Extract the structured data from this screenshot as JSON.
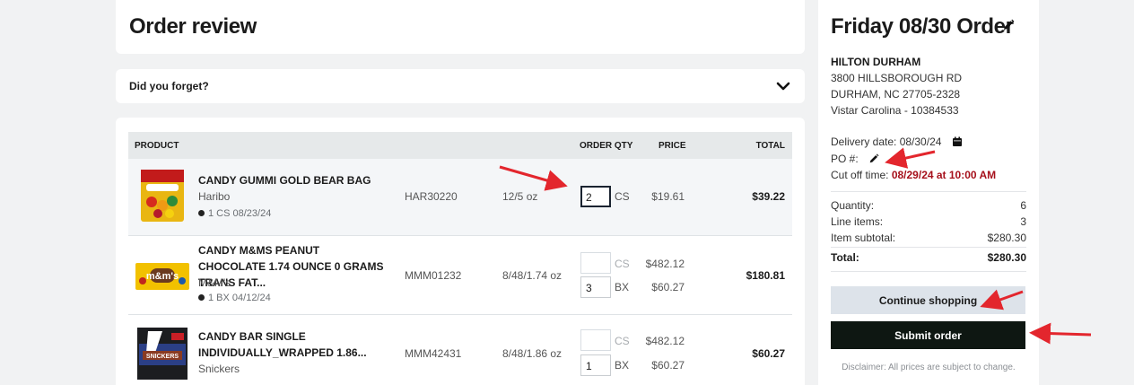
{
  "page": {
    "title": "Order review"
  },
  "forget": {
    "label": "Did you forget?"
  },
  "table": {
    "headers": {
      "product": "PRODUCT",
      "qty": "ORDER QTY",
      "price": "PRICE",
      "total": "TOTAL"
    },
    "rows": [
      {
        "name": "CANDY GUMMI GOLD BEAR BAG",
        "brand": "Haribo",
        "status": "1 CS 08/23/24",
        "sku": "HAR30220",
        "pack": "12/5 oz",
        "cs_qty": "2",
        "cs_unit": "CS",
        "cs_price": "$19.61",
        "total": "$39.22"
      },
      {
        "name": "CANDY M&MS PEANUT CHOCOLATE 1.74 OUNCE 0 GRAMS TRANS FAT...",
        "brand": "M&M's",
        "status": "1 BX 04/12/24",
        "sku": "MMM01232",
        "pack": "8/48/1.74 oz",
        "cs_qty": "",
        "cs_unit": "CS",
        "cs_price": "$482.12",
        "bx_qty": "3",
        "bx_unit": "BX",
        "bx_price": "$60.27",
        "total": "$180.81"
      },
      {
        "name": "CANDY BAR SINGLE INDIVIDUALLY_WRAPPED 1.86...",
        "brand": "Snickers",
        "sku": "MMM42431",
        "pack": "8/48/1.86 oz",
        "cs_qty": "",
        "cs_unit": "CS",
        "cs_price": "$482.12",
        "bx_qty": "1",
        "bx_unit": "BX",
        "bx_price": "$60.27",
        "total": "$60.27"
      }
    ]
  },
  "summary": {
    "title": "Friday 08/30 Order",
    "customer": "HILTON DURHAM",
    "address1": "3800 HILLSBOROUGH RD",
    "address2": "DURHAM, NC 27705-2328",
    "account": "Vistar Carolina - 10384533",
    "delivery_label": "Delivery date: 08/30/24",
    "po_label": "PO #:",
    "cutoff_label": "Cut off time:",
    "cutoff_value": "08/29/24 at 10:00 AM",
    "quantity_label": "Quantity:",
    "quantity_value": "6",
    "line_items_label": "Line items:",
    "line_items_value": "3",
    "subtotal_label": "Item subtotal:",
    "subtotal_value": "$280.30",
    "total_label": "Total:",
    "total_value": "$280.30",
    "continue_label": "Continue shopping",
    "submit_label": "Submit order",
    "disclaimer": "Disclaimer: All prices are subject to change."
  },
  "colors": {
    "accent_dark": "#0e1712",
    "cutoff_red": "#a6111c",
    "annotation_red": "#e3262d",
    "continue_bg": "#dde3ea"
  },
  "icons": {
    "edit": "pencil-icon",
    "calendar": "calendar-icon",
    "expand": "chevron-down-icon",
    "status": "dot-icon"
  }
}
